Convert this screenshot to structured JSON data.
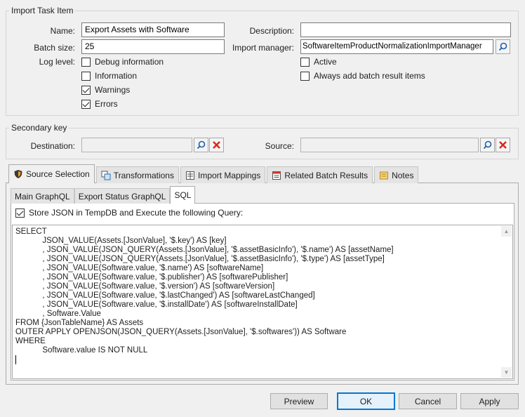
{
  "import_task": {
    "group_title": "Import Task Item",
    "name_label": "Name:",
    "name_value": "Export Assets with Software",
    "batch_label": "Batch size:",
    "batch_value": "25",
    "log_label": "Log level:",
    "description_label": "Description:",
    "description_value": "",
    "import_manager_label": "Import manager:",
    "import_manager_value": "SoftwareItemProductNormalizationImportManager",
    "log_levels": [
      {
        "label": "Debug information",
        "checked": false
      },
      {
        "label": "Information",
        "checked": false
      },
      {
        "label": "Warnings",
        "checked": true
      },
      {
        "label": "Errors",
        "checked": true
      }
    ],
    "active_label": "Active",
    "active_checked": false,
    "always_add_label": "Always add batch result items",
    "always_add_checked": false
  },
  "secondary_key": {
    "group_title": "Secondary key",
    "destination_label": "Destination:",
    "destination_value": "",
    "source_label": "Source:",
    "source_value": ""
  },
  "tabs": [
    {
      "label": "Source Selection",
      "icon": "shield-icon",
      "active": true
    },
    {
      "label": "Transformations",
      "icon": "transform-icon",
      "active": false
    },
    {
      "label": "Import Mappings",
      "icon": "mapping-icon",
      "active": false
    },
    {
      "label": "Related Batch Results",
      "icon": "batch-results-icon",
      "active": false
    },
    {
      "label": "Notes",
      "icon": "notes-icon",
      "active": false
    }
  ],
  "subtabs": [
    {
      "label": "Main GraphQL",
      "active": false
    },
    {
      "label": "Export Status GraphQL",
      "active": false
    },
    {
      "label": "SQL",
      "active": true
    }
  ],
  "store_json_label": "Store JSON in TempDB and Execute the following Query:",
  "store_json_checked": true,
  "sql_lines": [
    "SELECT",
    "            JSON_VALUE(Assets.[JsonValue], '$.key') AS [key]",
    "            , JSON_VALUE(JSON_QUERY(Assets.[JsonValue], '$.assetBasicInfo'), '$.name') AS [assetName]",
    "            , JSON_VALUE(JSON_QUERY(Assets.[JsonValue], '$.assetBasicInfo'), '$.type') AS [assetType]",
    "            , JSON_VALUE(Software.value, '$.name') AS [softwareName]",
    "            , JSON_VALUE(Software.value, '$.publisher') AS [softwarePublisher]",
    "            , JSON_VALUE(Software.value, '$.version') AS [softwareVersion]",
    "            , JSON_VALUE(Software.value, '$.lastChanged') AS [softwareLastChanged]",
    "            , JSON_VALUE(Software.value, '$.installDate') AS [softwareInstallDate]",
    "            , Software.Value",
    "FROM {JsonTableName} AS Assets",
    "OUTER APPLY OPENJSON(JSON_QUERY(Assets.[JsonValue], '$.softwares')) AS Software",
    "WHERE",
    "            Software.value IS NOT NULL",
    ""
  ],
  "buttons": {
    "preview": "Preview",
    "ok": "OK",
    "cancel": "Cancel",
    "apply": "Apply"
  },
  "colors": {
    "required_marker": "#e04020",
    "delete_red": "#d9251c",
    "primary_border": "#0078d7"
  }
}
